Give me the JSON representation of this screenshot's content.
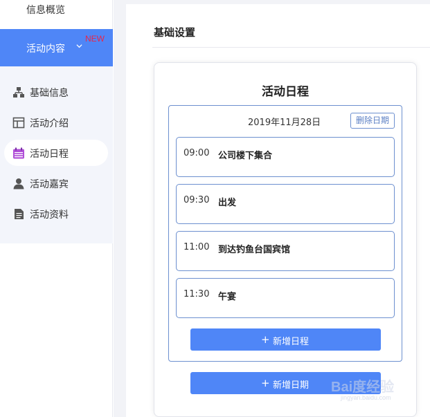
{
  "sidebar": {
    "overview_label": "信息概览",
    "active_group": {
      "label": "活动内容",
      "badge": "NEW",
      "badge_color": "#e8264a",
      "bg_color": "#4f86f7"
    },
    "items": [
      {
        "label": "基础信息",
        "icon": "sitemap-icon",
        "selected": false
      },
      {
        "label": "活动介绍",
        "icon": "layout-icon",
        "selected": false
      },
      {
        "label": "活动日程",
        "icon": "calendar-icon",
        "selected": true
      },
      {
        "label": "活动嘉宾",
        "icon": "user-icon",
        "selected": false
      },
      {
        "label": "活动资料",
        "icon": "document-icon",
        "selected": false
      }
    ]
  },
  "main": {
    "section_title": "基础设置",
    "card": {
      "title": "活动日程",
      "date_group": {
        "date": "2019年11月28日",
        "delete_label": "删除日期",
        "schedules": [
          {
            "time": "09:00",
            "desc": "公司楼下集合"
          },
          {
            "time": "09:30",
            "desc": "出发"
          },
          {
            "time": "11:00",
            "desc": "到达钓鱼台国宾馆"
          },
          {
            "time": "11:30",
            "desc": "午宴"
          }
        ],
        "add_schedule_label": "新增日程"
      },
      "add_date_label": "新增日期"
    }
  },
  "watermark": {
    "text": "Bai度经验",
    "url": "jingyan.baidu.com"
  },
  "colors": {
    "primary": "#4f86f7",
    "border": "#6c8fcf"
  }
}
